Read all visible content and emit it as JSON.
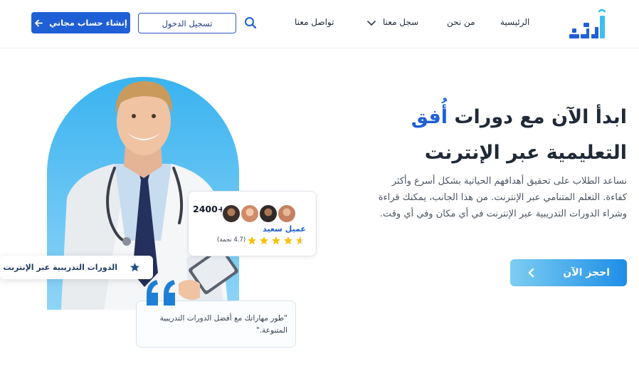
{
  "colors": {
    "primary": "#1f5fd6",
    "accent_cyan": "#3dc0ef",
    "dark_navy": "#1e3a8a",
    "star": "#f4c20d"
  },
  "logo": {
    "text": "أفق",
    "icon": "afaq-logo"
  },
  "nav": {
    "home": "الرئيسية",
    "about": "من نحن",
    "register": "سجل معنا",
    "contact": "تواصل معنا",
    "search_icon": "search-icon",
    "dropdown_icon": "chevron-down-icon"
  },
  "auth": {
    "login_label": "تسجيل الدخول",
    "signup_label": "إنشاء حساب مجاني",
    "signup_icon": "arrow-left-icon"
  },
  "hero": {
    "title_prefix": "ابدأ الآن مع دورات ",
    "title_brand": "أُفق",
    "title_line2": "التعليمية عبر الإنترنت",
    "description": "نساعد الطلاب على تحقيق أهدافهم الحياتية بشكل أسرع وأكثر كفاءة. التعلم المتنامي عبر الإنترنت. من هذا الجانب، يمكنك قراءة وشراء الدورات التدريبية عبر الإنترنت في أي مكان وفي أي وقت.",
    "cta_label": "احجز الآن",
    "cta_icon": "chevron-left-icon"
  },
  "stats_card": {
    "count": "2400+",
    "label": "عميل سعيد",
    "rating_text": "(4.7 نجمة)",
    "rating": 4.7,
    "stars_total": 5
  },
  "courses_badge": {
    "label": "الدورات التدريبية عبر الإنترنت",
    "icon": "star-icon"
  },
  "quote": {
    "text": "\"طور مهاراتك مع أفضل الدورات التدريبية المتنوعة.\"",
    "icon": "quote-icon"
  }
}
